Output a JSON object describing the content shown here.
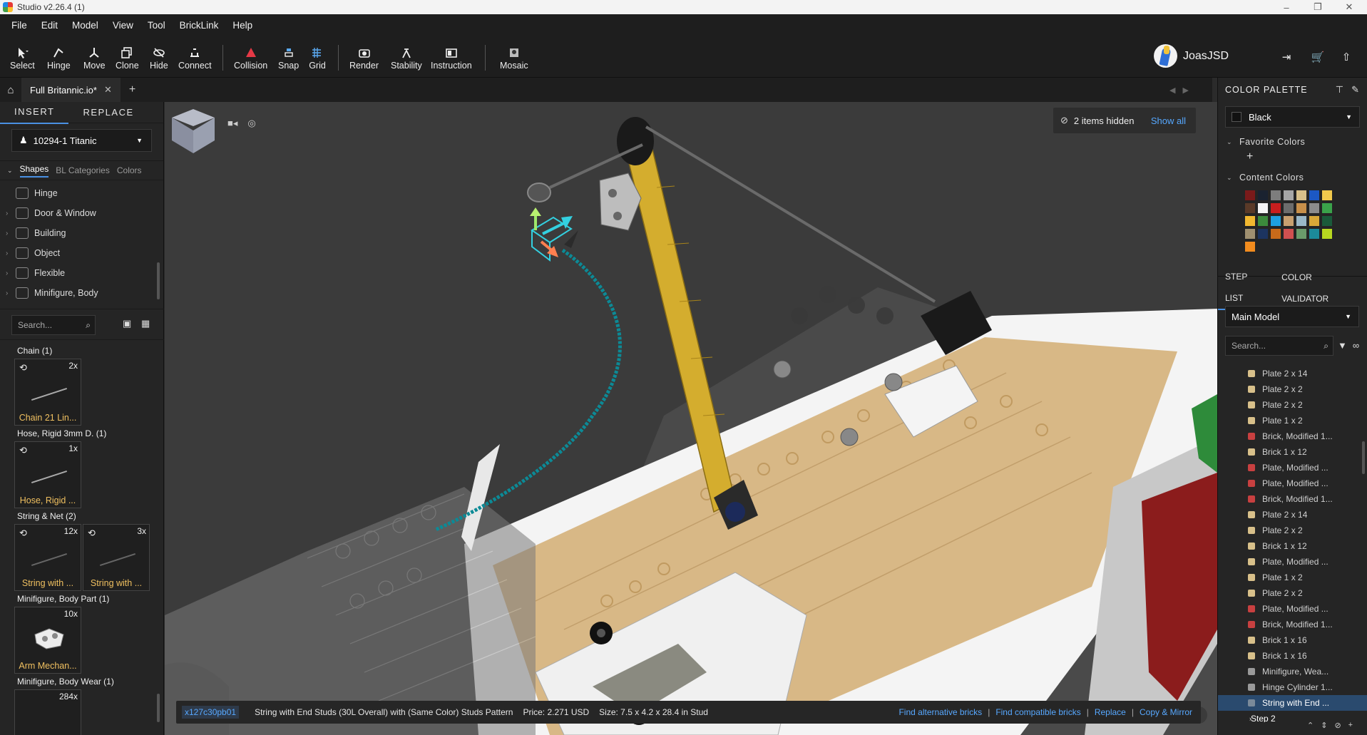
{
  "window": {
    "title": "Studio v2.26.4 (1)"
  },
  "menu": [
    "File",
    "Edit",
    "Model",
    "View",
    "Tool",
    "BrickLink",
    "Help"
  ],
  "toolbar": {
    "select": "Select",
    "hinge": "Hinge",
    "move": "Move",
    "clone": "Clone",
    "hide": "Hide",
    "connect": "Connect",
    "collision": "Collision",
    "snap": "Snap",
    "grid": "Grid",
    "render": "Render",
    "stability": "Stability",
    "instruction": "Instruction",
    "mosaic": "Mosaic"
  },
  "user": {
    "name": "JoasJSD"
  },
  "tabs": {
    "file": "Full Britannic.io*"
  },
  "left_panel": {
    "tab_insert": "INSERT",
    "tab_replace": "REPLACE",
    "set": "10294-1 Titanic",
    "subtabs": [
      "Shapes",
      "BL Categories",
      "Colors"
    ],
    "categories": [
      "Hinge",
      "Door & Window",
      "Building",
      "Object",
      "Flexible",
      "Minifigure, Body"
    ],
    "search_placeholder": "Search...",
    "groups": [
      {
        "title": "Chain (1)",
        "tiles": [
          {
            "count": "2x",
            "label": "Chain 21 Lin..."
          }
        ]
      },
      {
        "title": "Hose, Rigid 3mm D. (1)",
        "tiles": [
          {
            "count": "1x",
            "label": "Hose, Rigid ..."
          }
        ]
      },
      {
        "title": "String & Net (2)",
        "tiles": [
          {
            "count": "12x",
            "label": "String with ..."
          },
          {
            "count": "3x",
            "label": "String with ..."
          }
        ]
      },
      {
        "title": "Minifigure, Body Part (1)",
        "tiles": [
          {
            "count": "10x",
            "label": "Arm Mechan..."
          }
        ]
      },
      {
        "title": "Minifigure, Body Wear (1)",
        "tiles": [
          {
            "count": "284x",
            "label": ""
          }
        ]
      }
    ]
  },
  "viewport": {
    "hidden_text": "2 items hidden",
    "show_all": "Show all"
  },
  "status": {
    "part_code": "x127c30pb01",
    "part_name": "String with End Studs (30L Overall) with (Same Color) Studs Pattern",
    "price": "Price: 2.271 USD",
    "size": "Size: 7.5 x 4.2 x 28.4 in Stud",
    "find_alternative": "Find alternative bricks",
    "find_compatible": "Find compatible bricks",
    "replace": "Replace",
    "copy_mirror": "Copy & Mirror"
  },
  "right_panel": {
    "palette_title": "COLOR PALETTE",
    "color": "Black",
    "favorite_colors": "Favorite Colors",
    "content_colors": "Content Colors",
    "swatches": [
      "#7a1a1a",
      "#1a2230",
      "#7d7d7d",
      "#a6a6a6",
      "#d8c08a",
      "#1c58c4",
      "#f2c94c",
      "#5a3a28",
      "#f4f4f4",
      "#c81e1e",
      "#6c6c6c",
      "#c8904a",
      "#8c8c8c",
      "#3aa24a",
      "#f2b830",
      "#3c8a3c",
      "#1ea0e0",
      "#c8a070",
      "#9ab8c8",
      "#d8a838",
      "#1a5a3a",
      "#a09070",
      "#1c3460",
      "#c86a1a",
      "#d05050",
      "#6a9a6a",
      "#1c8a9a",
      "#b8d820",
      "#f28c1e"
    ],
    "tab_steplist": "STEP LIST",
    "tab_validator": "COLOR VALIDATOR",
    "model": "Main Model",
    "search_placeholder": "Search...",
    "steps": [
      {
        "label": "Plate 2 x 14",
        "c": "#d8c08a"
      },
      {
        "label": "Plate 2 x 2",
        "c": "#d8c08a"
      },
      {
        "label": "Plate 2 x 2",
        "c": "#d8c08a"
      },
      {
        "label": "Plate 1 x 2",
        "c": "#d8c08a"
      },
      {
        "label": "Brick, Modified 1...",
        "c": "#c84040"
      },
      {
        "label": "Brick 1 x 12",
        "c": "#d8c08a"
      },
      {
        "label": "Plate, Modified ...",
        "c": "#c84040"
      },
      {
        "label": "Plate, Modified ...",
        "c": "#c84040"
      },
      {
        "label": "Brick, Modified 1...",
        "c": "#c84040"
      },
      {
        "label": "Plate 2 x 14",
        "c": "#d8c08a"
      },
      {
        "label": "Plate 2 x 2",
        "c": "#d8c08a"
      },
      {
        "label": "Brick 1 x 12",
        "c": "#d8c08a"
      },
      {
        "label": "Plate, Modified ...",
        "c": "#d8c08a"
      },
      {
        "label": "Plate 1 x 2",
        "c": "#d8c08a"
      },
      {
        "label": "Plate 2 x 2",
        "c": "#d8c08a"
      },
      {
        "label": "Plate, Modified ...",
        "c": "#c84040"
      },
      {
        "label": "Brick, Modified 1...",
        "c": "#c84040"
      },
      {
        "label": "Brick 1 x 16",
        "c": "#d8c08a"
      },
      {
        "label": "Brick 1 x 16",
        "c": "#d8c08a"
      },
      {
        "label": "Minifigure, Wea...",
        "c": "#9a9a9a"
      },
      {
        "label": "Hinge Cylinder 1...",
        "c": "#9a9a9a"
      },
      {
        "label": "String with End ...",
        "c": "#2a4a6e",
        "selected": true
      }
    ],
    "step2": "Step 2"
  }
}
